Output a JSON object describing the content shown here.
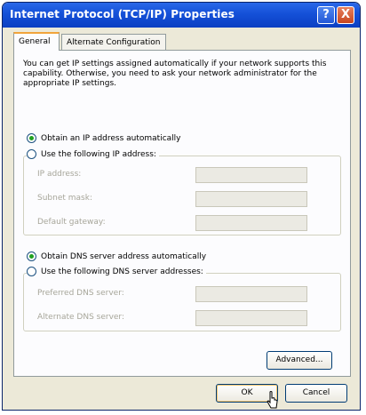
{
  "window": {
    "title": "Internet Protocol (TCP/IP) Properties",
    "help_label": "?",
    "close_label": "X"
  },
  "tabs": [
    {
      "label": "General",
      "active": true
    },
    {
      "label": "Alternate Configuration",
      "active": false
    }
  ],
  "description": "You can get IP settings assigned automatically if your network supports this capability. Otherwise, you need to ask your network administrator for the appropriate IP settings.",
  "ip_section": {
    "auto_label": "Obtain an IP address automatically",
    "auto_selected": true,
    "manual_label": "Use the following IP address:",
    "fields": [
      {
        "label": "IP address:",
        "value": ""
      },
      {
        "label": "Subnet mask:",
        "value": ""
      },
      {
        "label": "Default gateway:",
        "value": ""
      }
    ]
  },
  "dns_section": {
    "auto_label": "Obtain DNS server address automatically",
    "auto_selected": true,
    "manual_label": "Use the following DNS server addresses:",
    "fields": [
      {
        "label": "Preferred DNS server:",
        "value": ""
      },
      {
        "label": "Alternate DNS server:",
        "value": ""
      }
    ]
  },
  "buttons": {
    "advanced": "Advanced...",
    "ok": "OK",
    "cancel": "Cancel"
  },
  "colors": {
    "title_bar": "#1450d8",
    "dialog_bg": "#ece9d8",
    "tab_highlight": "#f1a43b",
    "radio_dot": "#21a121"
  }
}
